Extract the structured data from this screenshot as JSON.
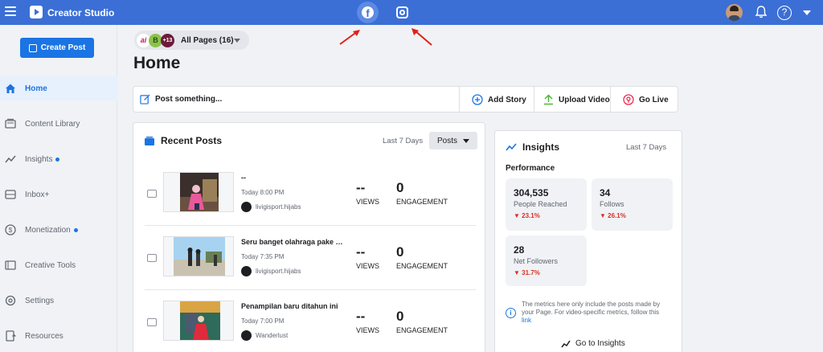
{
  "topbar": {
    "app_title": "Creator Studio",
    "platform_tabs": [
      {
        "name": "facebook",
        "active": true
      },
      {
        "name": "instagram",
        "active": false
      }
    ],
    "help_glyph": "?"
  },
  "sidebar": {
    "create_post_label": "Create Post",
    "items": [
      {
        "label": "Home",
        "icon": "home-icon",
        "active": true,
        "dot": false
      },
      {
        "label": "Content Library",
        "icon": "library-icon",
        "active": false,
        "dot": false
      },
      {
        "label": "Insights",
        "icon": "insights-icon",
        "active": false,
        "dot": true
      },
      {
        "label": "Inbox+",
        "icon": "inbox-icon",
        "active": false,
        "dot": false
      },
      {
        "label": "Monetization",
        "icon": "dollar-icon",
        "active": false,
        "dot": true
      },
      {
        "label": "Creative Tools",
        "icon": "tools-icon",
        "active": false,
        "dot": false
      },
      {
        "label": "Settings",
        "icon": "settings-icon",
        "active": false,
        "dot": false
      },
      {
        "label": "Resources",
        "icon": "resources-icon",
        "active": false,
        "dot": false
      }
    ]
  },
  "pages_selector": {
    "avatars": [
      "ai",
      "B",
      "+13"
    ],
    "label": "All Pages (16)"
  },
  "page_title": "Home",
  "post_bar": {
    "placeholder": "Post something...",
    "add_story": "Add Story",
    "upload_video": "Upload Video",
    "go_live": "Go Live"
  },
  "recent_posts": {
    "title": "Recent Posts",
    "range": "Last 7 Days",
    "filter": "Posts",
    "views_label": "VIEWS",
    "engagement_label": "ENGAGEMENT",
    "posts": [
      {
        "title": "--",
        "time": "Today 8:00 PM",
        "account": "livigisport.hijabs",
        "views": "--",
        "engagement": "0"
      },
      {
        "title": "Seru banget olahraga pake hijab",
        "time": "Today 7:35 PM",
        "account": "livigisport.hijabs",
        "views": "--",
        "engagement": "0"
      },
      {
        "title": "Penampilan baru ditahun ini",
        "time": "Today 7:00 PM",
        "account": "Wanderlust",
        "views": "--",
        "engagement": "0"
      }
    ]
  },
  "insights": {
    "title": "Insights",
    "range": "Last 7 Days",
    "performance_label": "Performance",
    "metrics": [
      {
        "value": "304,535",
        "label": "People Reached",
        "change": "23.1%"
      },
      {
        "value": "34",
        "label": "Follows",
        "change": "26.1%"
      },
      {
        "value": "28",
        "label": "Net Followers",
        "change": "31.7%"
      }
    ],
    "note": "The metrics here only include the posts made by your Page. For video-specific metrics, follow this",
    "note_link": "link",
    "go_label": "Go to Insights"
  },
  "colors": {
    "topbar": "#3b6fd6",
    "primary": "#1b74e4",
    "negative": "#d93025",
    "annotation_arrow": "#e0201b"
  }
}
